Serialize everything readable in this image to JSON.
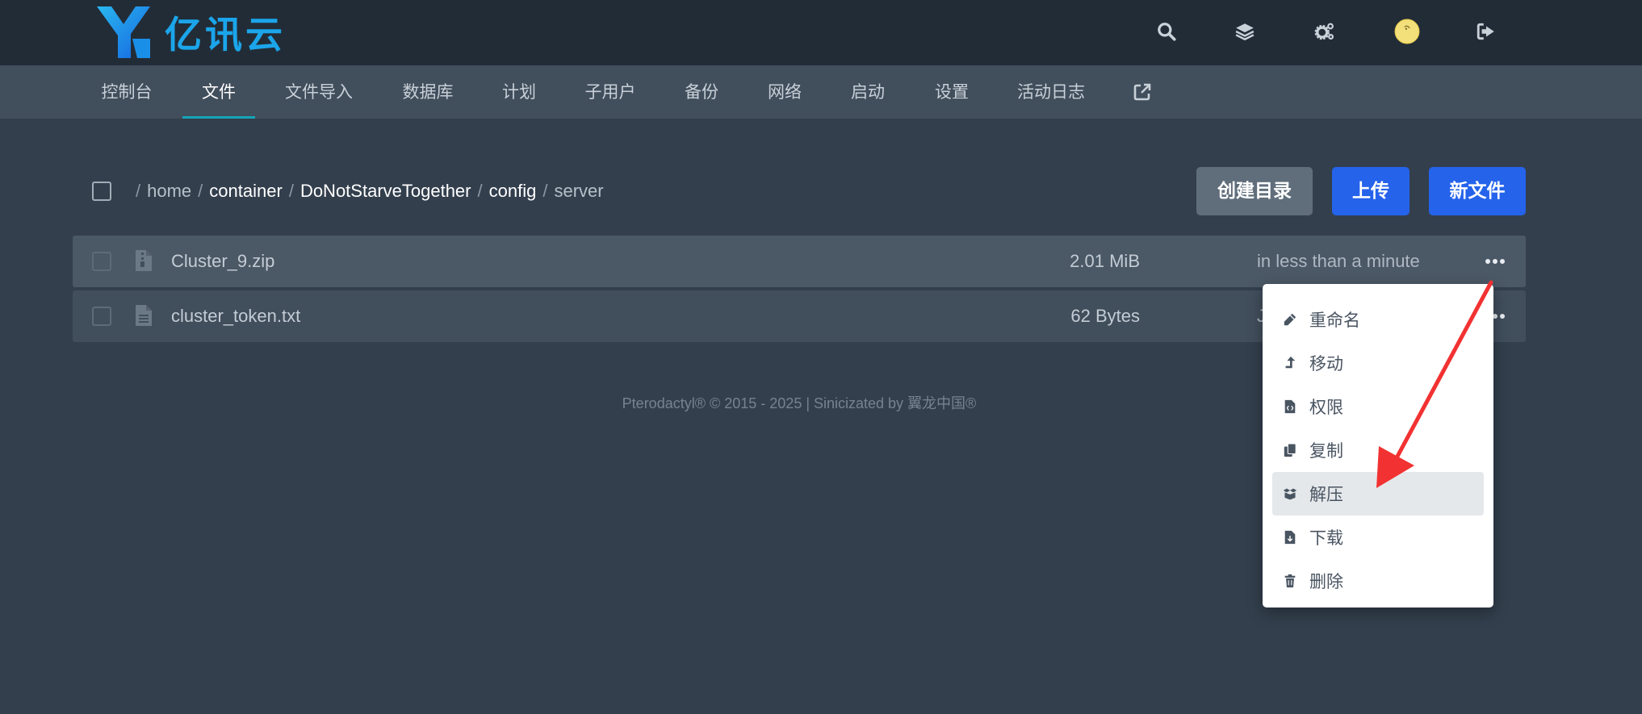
{
  "brand": {
    "logo_text": "亿讯云",
    "color": "#1ba5ea"
  },
  "top_icons": [
    {
      "name": "search-icon"
    },
    {
      "name": "layers-icon"
    },
    {
      "name": "gears-icon"
    },
    {
      "name": "avatar"
    },
    {
      "name": "logout-icon"
    }
  ],
  "nav": {
    "items": [
      {
        "label": "控制台"
      },
      {
        "label": "文件"
      },
      {
        "label": "文件导入"
      },
      {
        "label": "数据库"
      },
      {
        "label": "计划"
      },
      {
        "label": "子用户"
      },
      {
        "label": "备份"
      },
      {
        "label": "网络"
      },
      {
        "label": "启动"
      },
      {
        "label": "设置"
      },
      {
        "label": "活动日志"
      }
    ],
    "active_index": 1
  },
  "breadcrumb": {
    "separator": "/",
    "parts": [
      "home",
      "container",
      "DoNotStarveTogether",
      "config",
      "server"
    ]
  },
  "toolbar": {
    "create_dir_label": "创建目录",
    "upload_label": "上传",
    "new_file_label": "新文件"
  },
  "files": [
    {
      "name": "Cluster_9.zip",
      "size": "2.01 MiB",
      "modified": "in less than a minute",
      "type": "archive"
    },
    {
      "name": "cluster_token.txt",
      "size": "62 Bytes",
      "modified": "Ju",
      "type": "text"
    }
  ],
  "footer": {
    "text": "Pterodactyl® © 2015 - 2025 | Sinicizated by 翼龙中国®"
  },
  "context_menu": {
    "highlighted_index": 4,
    "items": [
      {
        "label": "重命名",
        "icon": "pencil-icon"
      },
      {
        "label": "移动",
        "icon": "level-up-icon"
      },
      {
        "label": "权限",
        "icon": "file-code-icon"
      },
      {
        "label": "复制",
        "icon": "copy-icon"
      },
      {
        "label": "解压",
        "icon": "box-open-icon"
      },
      {
        "label": "下载",
        "icon": "file-download-icon"
      },
      {
        "label": "删除",
        "icon": "trash-icon"
      }
    ]
  },
  "colors": {
    "background": "#333f4d",
    "topbar": "#222c37",
    "navbar": "#414e5c",
    "accent_blue": "#2563eb",
    "nav_active_underline": "#16a4b8",
    "annotation_arrow": "#f23232"
  }
}
